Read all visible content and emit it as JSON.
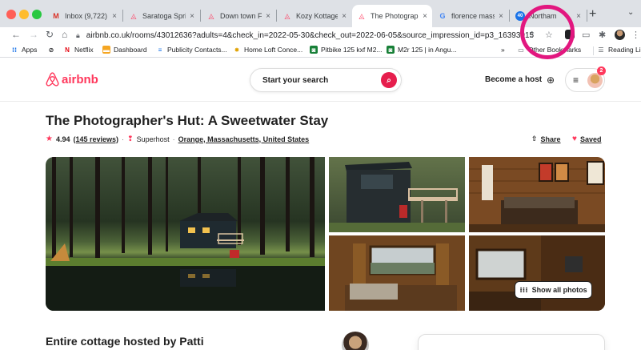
{
  "browser": {
    "tabs": [
      {
        "icon": "gmail-icon",
        "title": "Inbox (9,722) -"
      },
      {
        "icon": "airbnb-icon",
        "title": "Saratoga Sprin"
      },
      {
        "icon": "airbnb-icon",
        "title": "Down town Flo"
      },
      {
        "icon": "airbnb-icon",
        "title": "Kozy Kottage"
      },
      {
        "icon": "airbnb-icon",
        "title": "The Photograp",
        "active": true
      },
      {
        "icon": "google-icon",
        "title": "florence mass"
      },
      {
        "icon": "weather-icon",
        "title": "Northam"
      }
    ],
    "url": "airbnb.co.uk/rooms/43012636?adults=4&check_in=2022-05-30&check_out=2022-06-05&source_impression_id=p3_16393015",
    "bookmarks": [
      {
        "icon": "apps-icon",
        "label": "Apps"
      },
      {
        "icon": "netflix-icon",
        "label": "Netflix"
      },
      {
        "icon": "dashboard-icon",
        "label": "Dashboard"
      },
      {
        "icon": "contacts-icon",
        "label": "Publicity Contacts..."
      },
      {
        "icon": "homeloft-icon",
        "label": "Home Loft Conce..."
      },
      {
        "icon": "pitbike-icon",
        "label": "Pitbike 125 kxf M2..."
      },
      {
        "icon": "m2r-icon",
        "label": "M2r 125 | in Angu..."
      }
    ],
    "bookmarks_overflow": "»",
    "other_bookmarks": "Other Bookmarks",
    "reading_list": "Reading List"
  },
  "header": {
    "logo_text": "airbnb",
    "search_placeholder": "Start your search",
    "become_host": "Become a host",
    "notification_count": "2"
  },
  "listing": {
    "title": "The Photographer's Hut: A Sweetwater Stay",
    "rating": "4.94",
    "reviews": "(145 reviews)",
    "superhost": "Superhost",
    "location": "Orange, Massachusetts, United States",
    "share": "Share",
    "saved": "Saved",
    "show_all_photos": "Show all photos",
    "hosted_by": "Entire cottage hosted by Patti"
  },
  "colors": {
    "brand": "#ff385c",
    "annotation": "#e2177f"
  }
}
